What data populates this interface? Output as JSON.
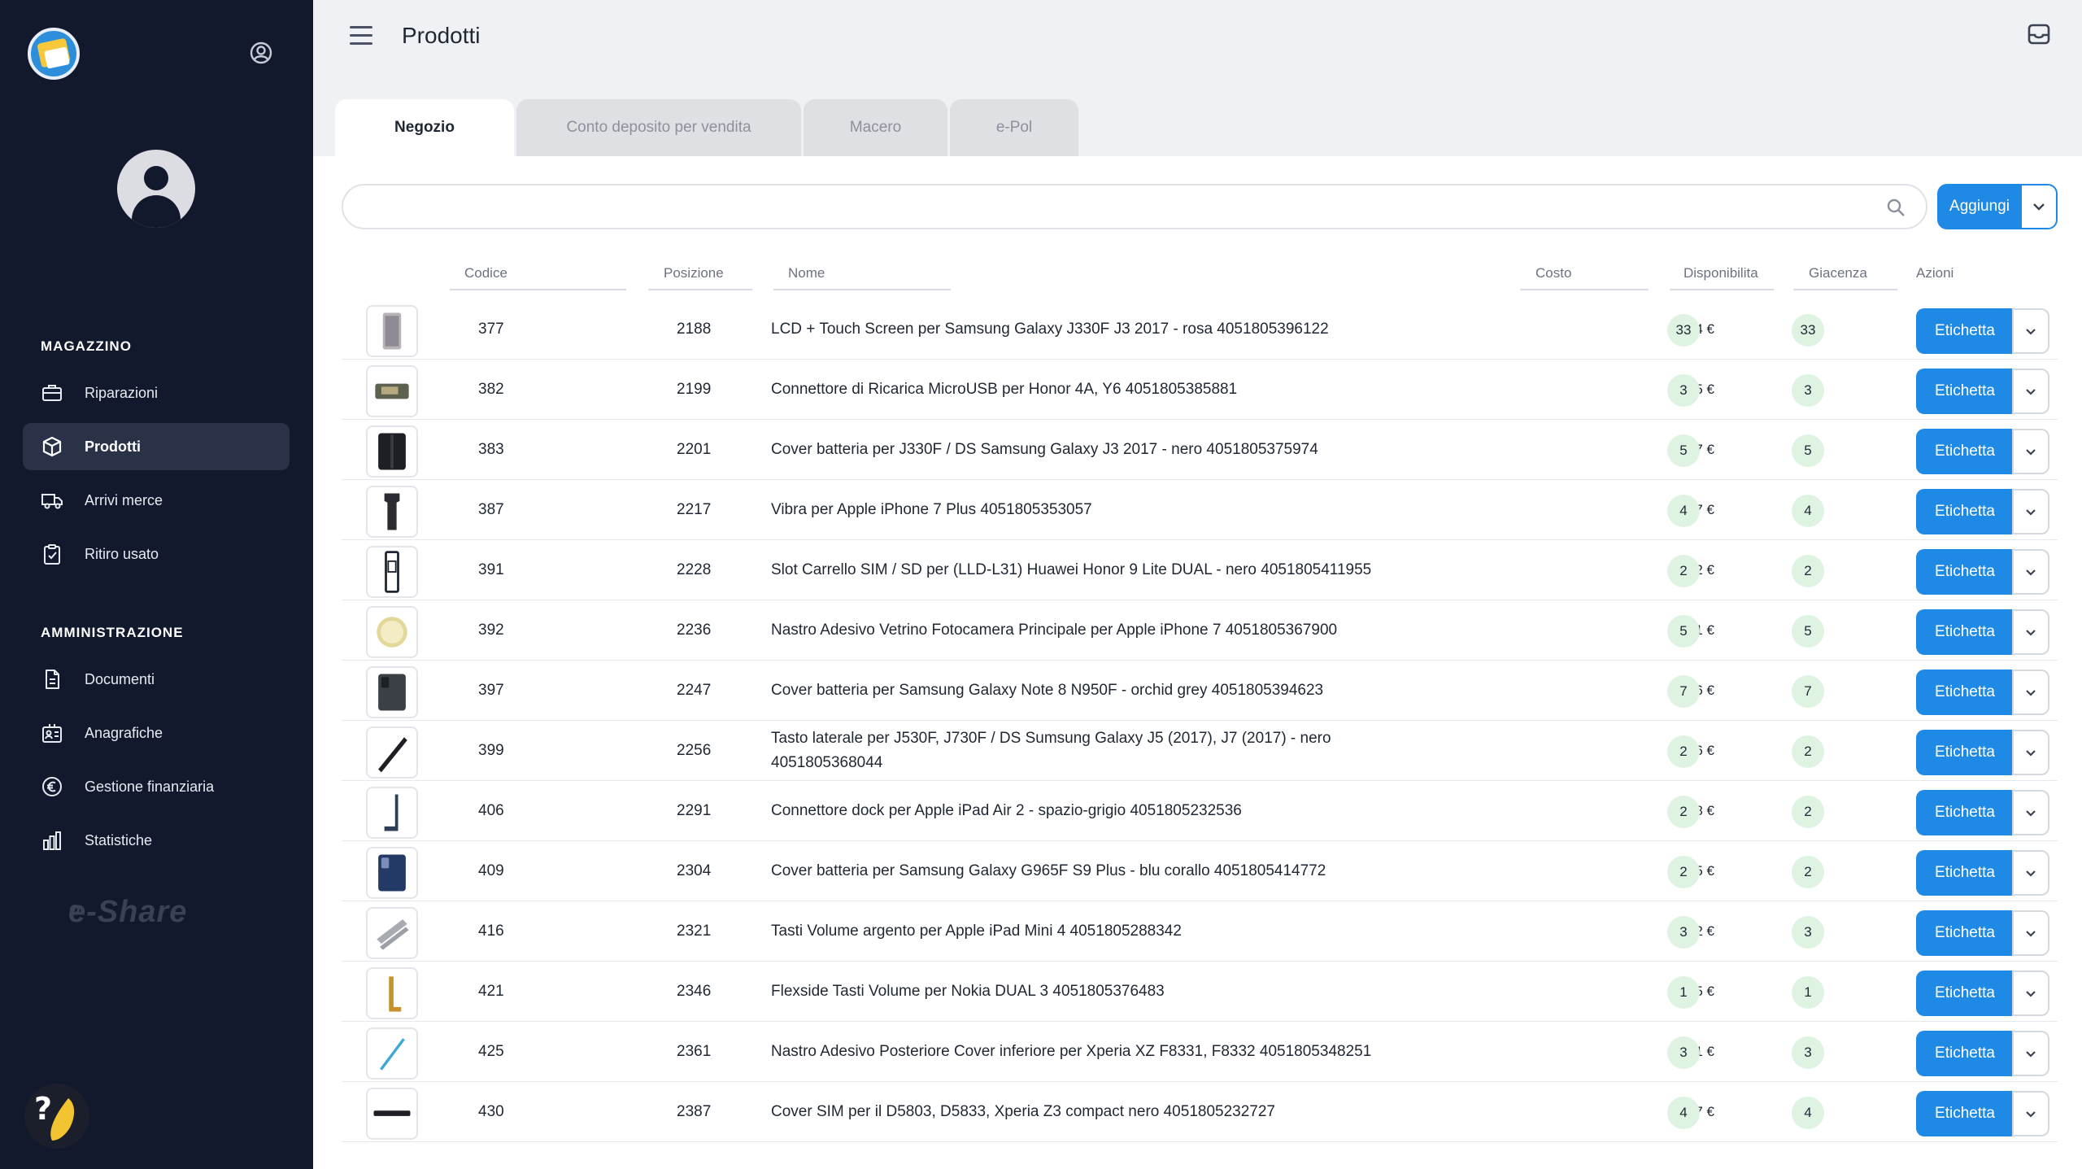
{
  "colors": {
    "sidebar_bg": "#12192c",
    "accent": "#1f8ae6",
    "pill_bg": "#dff3e3"
  },
  "header": {
    "title": "Prodotti"
  },
  "sidebar": {
    "brand": "e-Share",
    "sections": [
      {
        "title": "MAGAZZINO",
        "items": [
          {
            "label": "Riparazioni",
            "icon": "toolbox-icon"
          },
          {
            "label": "Prodotti",
            "icon": "box-icon",
            "active": true
          },
          {
            "label": "Arrivi merce",
            "icon": "truck-icon"
          },
          {
            "label": "Ritiro usato",
            "icon": "clipboard-icon"
          }
        ]
      },
      {
        "title": "AMMINISTRAZIONE",
        "items": [
          {
            "label": "Documenti",
            "icon": "document-icon"
          },
          {
            "label": "Anagrafiche",
            "icon": "contacts-icon"
          },
          {
            "label": "Gestione finanziaria",
            "icon": "euro-icon"
          },
          {
            "label": "Statistiche",
            "icon": "bar-chart-icon"
          }
        ]
      }
    ]
  },
  "tabs": [
    {
      "label": "Negozio",
      "active": true
    },
    {
      "label": "Conto deposito per vendita"
    },
    {
      "label": "Macero"
    },
    {
      "label": "e-Pol"
    }
  ],
  "search": {
    "placeholder": ""
  },
  "toolbar": {
    "add_label": "Aggiungi"
  },
  "table": {
    "columns": {
      "code": "Codice",
      "pos": "Posizione",
      "name": "Nome",
      "cost": "Costo",
      "disp": "Disponibilita",
      "giac": "Giacenza",
      "actions": "Azioni"
    },
    "action_label": "Etichetta",
    "rows": [
      {
        "code": "377",
        "pos": "2188",
        "name": "LCD + Touch Screen per Samsung Galaxy J330F J3 2017 - rosa 4051805396122",
        "cost": "27,64 €",
        "disp": "33",
        "giac": "33"
      },
      {
        "code": "382",
        "pos": "2199",
        "name": "Connettore di Ricarica MicroUSB per Honor 4A, Y6 4051805385881",
        "cost": "1,85 €",
        "disp": "3",
        "giac": "3"
      },
      {
        "code": "383",
        "pos": "2201",
        "name": "Cover batteria per J330F / DS Samsung Galaxy J3 2017 - nero 4051805375974",
        "cost": "28,27 €",
        "disp": "5",
        "giac": "5"
      },
      {
        "code": "387",
        "pos": "2217",
        "name": "Vibra per Apple iPhone 7 Plus 4051805353057",
        "cost": "5,47 €",
        "disp": "4",
        "giac": "4"
      },
      {
        "code": "391",
        "pos": "2228",
        "name": "Slot Carrello SIM / SD per (LLD-L31) Huawei Honor 9 Lite DUAL - nero 4051805411955",
        "cost": "3,92 €",
        "disp": "2",
        "giac": "2"
      },
      {
        "code": "392",
        "pos": "2236",
        "name": "Nastro Adesivo Vetrino Fotocamera Principale per Apple iPhone 7 4051805367900",
        "cost": "1,81 €",
        "disp": "5",
        "giac": "5"
      },
      {
        "code": "397",
        "pos": "2247",
        "name": "Cover batteria per Samsung Galaxy Note 8 N950F - orchid grey 4051805394623",
        "cost": "21,76 €",
        "disp": "7",
        "giac": "7"
      },
      {
        "code": "399",
        "pos": "2256",
        "name": "Tasto laterale per J530F, J730F / DS Sumsung Galaxy J5 (2017), J7 (2017) - nero 4051805368044",
        "cost": "2,66 €",
        "disp": "2",
        "giac": "2"
      },
      {
        "code": "406",
        "pos": "2291",
        "name": "Connettore dock per Apple iPad Air 2 - spazio-grigio 4051805232536",
        "cost": "2,98 €",
        "disp": "2",
        "giac": "2"
      },
      {
        "code": "409",
        "pos": "2304",
        "name": "Cover batteria per Samsung Galaxy G965F S9 Plus - blu corallo 4051805414772",
        "cost": "26,25 €",
        "disp": "2",
        "giac": "2"
      },
      {
        "code": "416",
        "pos": "2321",
        "name": "Tasti Volume argento per Apple iPad Mini 4 4051805288342",
        "cost": "3,32 €",
        "disp": "3",
        "giac": "3"
      },
      {
        "code": "421",
        "pos": "2346",
        "name": "Flexside Tasti Volume per Nokia DUAL 3 4051805376483",
        "cost": "2,95 €",
        "disp": "1",
        "giac": "1"
      },
      {
        "code": "425",
        "pos": "2361",
        "name": "Nastro Adesivo Posteriore Cover inferiore per Xperia XZ F8331, F8332 4051805348251",
        "cost": "2,31 €",
        "disp": "3",
        "giac": "3"
      },
      {
        "code": "430",
        "pos": "2387",
        "name": "Cover SIM per il D5803, D5833, Xperia Z3 compact nero 4051805232727",
        "cost": "2,07 €",
        "disp": "4",
        "giac": "4"
      }
    ]
  }
}
